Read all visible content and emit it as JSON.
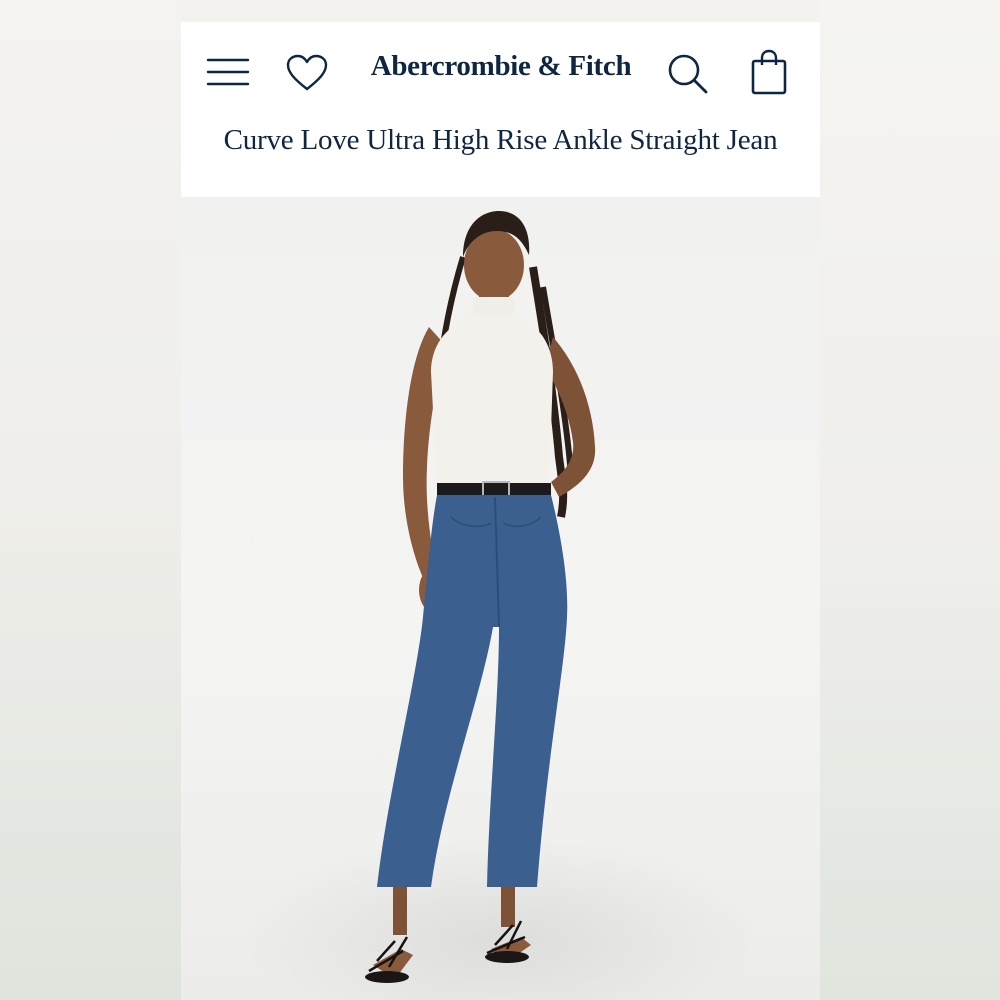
{
  "header": {
    "brand_name": "Abercrombie & Fitch",
    "icons": [
      "menu-icon",
      "heart-icon",
      "search-icon",
      "shopping-bag-icon"
    ]
  },
  "product": {
    "title": "Curve Love Ultra High Rise Ankle Straight Jean"
  },
  "colors": {
    "brand_navy": "#0f2643",
    "background": "#ffffff",
    "denim": "#3b5f8e",
    "top": "#f2f1ec"
  }
}
